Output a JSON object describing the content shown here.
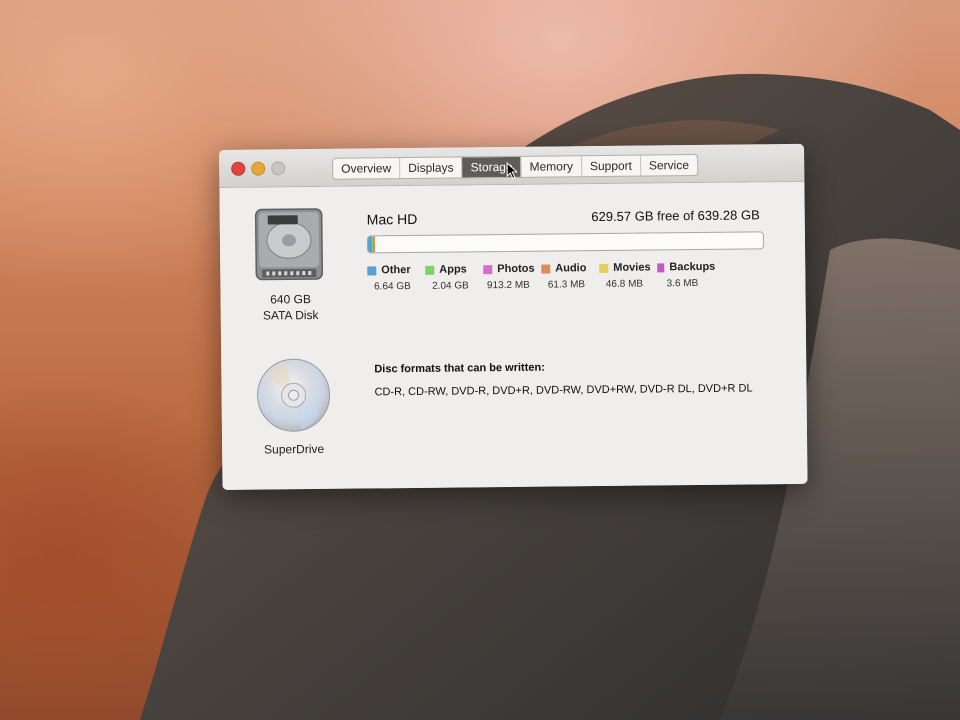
{
  "tabs": [
    "Overview",
    "Displays",
    "Storage",
    "Memory",
    "Support",
    "Service"
  ],
  "active_tab": "Storage",
  "drive": {
    "size": "640 GB",
    "type": "SATA Disk",
    "volume_name": "Mac HD",
    "free_text": "629.57 GB free of 639.28 GB"
  },
  "legend": [
    {
      "label": "Other",
      "value": "6.64 GB",
      "color": "#5aa0d6"
    },
    {
      "label": "Apps",
      "value": "2.04 GB",
      "color": "#7fcf6b"
    },
    {
      "label": "Photos",
      "value": "913.2 MB",
      "color": "#d16fcf"
    },
    {
      "label": "Audio",
      "value": "61.3 MB",
      "color": "#e08a5a"
    },
    {
      "label": "Movies",
      "value": "46.8 MB",
      "color": "#e3cf5e"
    },
    {
      "label": "Backups",
      "value": "3.6 MB",
      "color": "#c05ac4"
    }
  ],
  "optical": {
    "name": "SuperDrive",
    "formats_title": "Disc formats that can be written:",
    "formats": "CD-R, CD-RW, DVD-R, DVD+R, DVD-RW, DVD+RW, DVD-R DL, DVD+R DL"
  },
  "icons": {
    "close": "close-button-red",
    "minimize": "minimize-button-yellow",
    "zoom": "zoom-button-gray",
    "hard_drive": "hard-drive-icon",
    "disc": "optical-disc-icon",
    "cursor": "arrow-cursor"
  }
}
